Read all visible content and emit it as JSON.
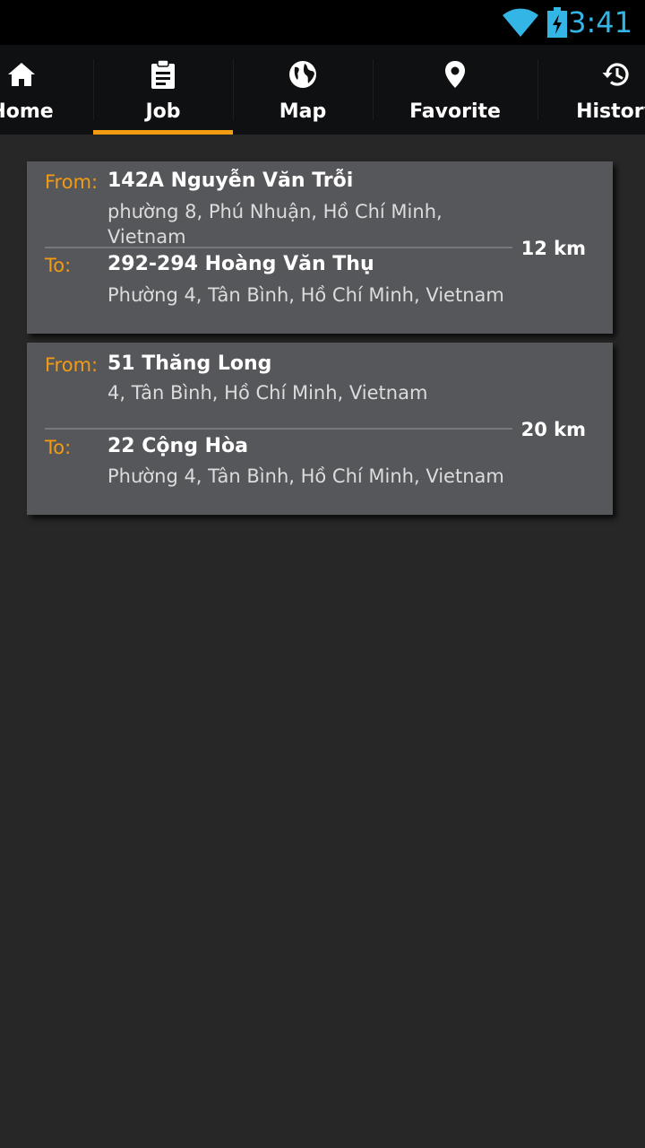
{
  "status_bar": {
    "time": "3:41",
    "icons": [
      "wifi-icon",
      "battery-charging-icon"
    ],
    "accent_color": "#33b5e5"
  },
  "tabs": [
    {
      "label": "Home",
      "icon": "home-icon",
      "selected": false
    },
    {
      "label": "Job",
      "icon": "clipboard-icon",
      "selected": true
    },
    {
      "label": "Map",
      "icon": "globe-icon",
      "selected": false
    },
    {
      "label": "Favorite",
      "icon": "location-pin-icon",
      "selected": false
    },
    {
      "label": "History",
      "icon": "history-icon",
      "selected": false
    }
  ],
  "colors": {
    "accent": "#f39c12",
    "card_background": "#56575b",
    "background": "#272727"
  },
  "jobs": [
    {
      "from_label": "From:",
      "from_main": "142A Nguyễn Văn Trỗi",
      "from_sub": "phường 8, Phú Nhuận, Hồ Chí Minh, Vietnam",
      "to_label": "To:",
      "to_main": "292-294 Hoàng Văn Thụ",
      "to_sub": "Phường 4, Tân Bình, Hồ Chí Minh, Vietnam",
      "distance": "12 km"
    },
    {
      "from_label": "From:",
      "from_main": "51 Thăng Long",
      "from_sub": "4, Tân Bình, Hồ Chí Minh, Vietnam",
      "to_label": "To:",
      "to_main": "22 Cộng Hòa",
      "to_sub": "Phường 4, Tân Bình, Hồ Chí Minh, Vietnam",
      "distance": "20 km"
    }
  ]
}
